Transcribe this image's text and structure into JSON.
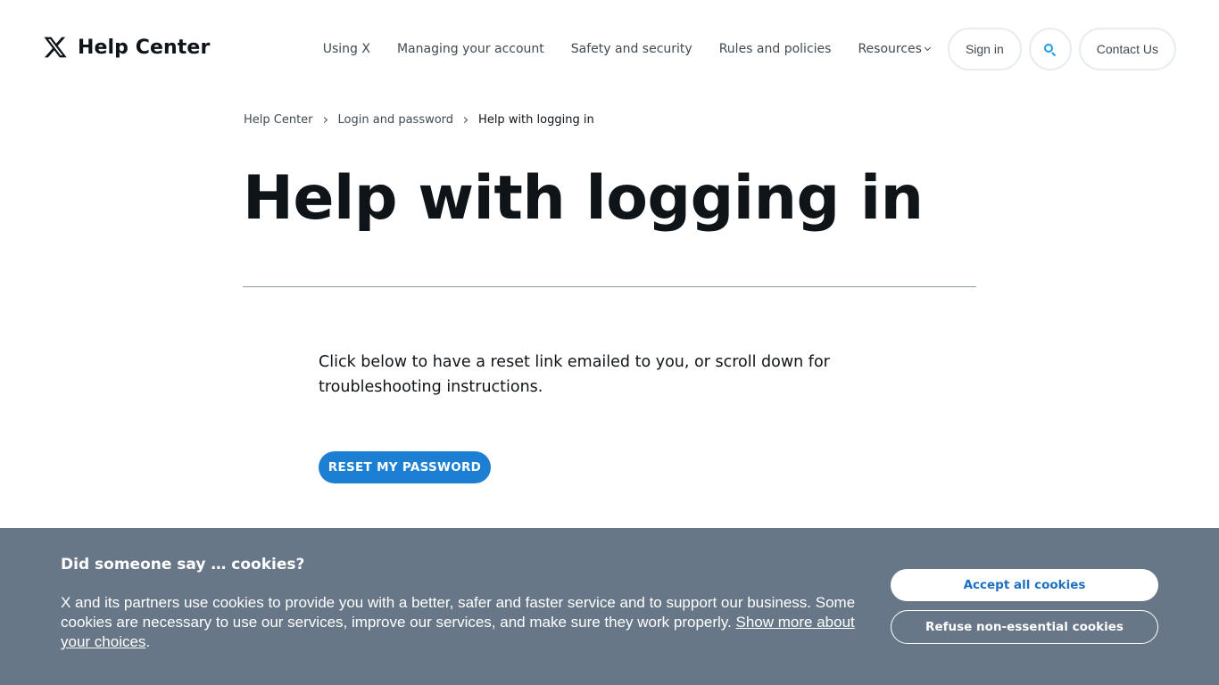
{
  "header": {
    "logo_text": "Help Center",
    "nav": [
      {
        "label": "Using X"
      },
      {
        "label": "Managing your account"
      },
      {
        "label": "Safety and security"
      },
      {
        "label": "Rules and policies"
      },
      {
        "label": "Resources"
      }
    ],
    "sign_in": "Sign in",
    "contact": "Contact Us",
    "search_icon": "search-icon",
    "accent_color": "#1d9bf0"
  },
  "breadcrumb": [
    "Help Center",
    "Login and password",
    "Help with logging in"
  ],
  "page": {
    "title": "Help with logging in",
    "intro": "Click below to have a reset link emailed to you, or scroll down for troubleshooting instructions.",
    "reset_button": "RESET MY PASSWORD",
    "button_color": "#1d7fd1"
  },
  "cookie_banner": {
    "title": "Did someone say … cookies?",
    "text": "X and its partners use cookies to provide you with a better, safer and faster service and to support our business. Some cookies are necessary to use our services, improve our services, and make sure they work properly.",
    "link": "Show more about your choices",
    "link_suffix": ".",
    "accept": "Accept all cookies",
    "refuse": "Refuse non-essential cookies",
    "background": "#677787"
  }
}
